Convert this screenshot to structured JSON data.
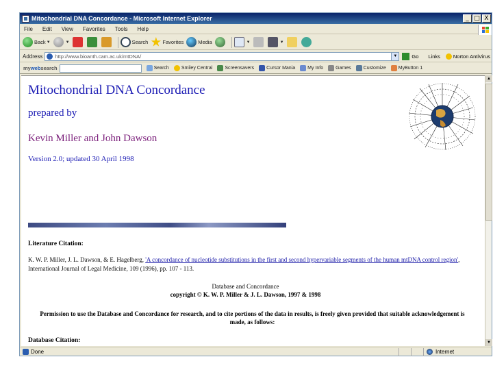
{
  "window": {
    "title": "Mitochondrial DNA Concordance - Microsoft Internet Explorer",
    "controls": [
      "_",
      "□",
      "X"
    ]
  },
  "menu": [
    "File",
    "Edit",
    "View",
    "Favorites",
    "Tools",
    "Help"
  ],
  "toolbar": {
    "back": "Back",
    "search": "Search",
    "favorites": "Favorites",
    "media": "Media"
  },
  "address": {
    "label": "Address",
    "url": "http://www.bioanth.cam.ac.uk/mtDNA/",
    "go": "Go",
    "links": "Links",
    "norton": "Norton AntiVirus"
  },
  "search_toolbar": {
    "logo_prefix": "my",
    "logo_brand": "web",
    "logo_suffix": "search",
    "search_button": "Search",
    "items": [
      "Smiley Central",
      "Screensavers",
      "Cursor Mania",
      "My Info",
      "Games",
      "Customize",
      "MyButton 1"
    ]
  },
  "content": {
    "title": "Mitochondrial DNA Concordance",
    "prepared_by": "prepared by",
    "authors": "Kevin Miller and John Dawson",
    "version": "Version 2.0; updated 30 April 1998",
    "lit_heading": "Literature Citation:",
    "citation_authors": "K. W. P. Miller, J. L. Dawson, & E. Hagelberg, ",
    "citation_title": "'A concordance of nucleotide substitutions in the first and second hypervariable segments of the human mtDNA control region'",
    "citation_journal": ", International Journal of Legal Medicine, 109 (1996), pp. 107 - 113.",
    "db_title": "Database and Concordance",
    "copyright": "copyright © K. W. P. Miller & J. L. Dawson, 1997 & 1998",
    "permission": "Permission to use the Database and Concordance for research, and to cite portions of the data in results, is freely given provided that suitable acknowledgement is made, as follows:",
    "db_heading": "Database Citation:"
  },
  "status": {
    "text": "Done",
    "zone": "Internet"
  },
  "colors": {
    "title_blue": "#1c1cb4",
    "author_purple": "#7a1e7a",
    "titlebar": "#0a246a"
  }
}
